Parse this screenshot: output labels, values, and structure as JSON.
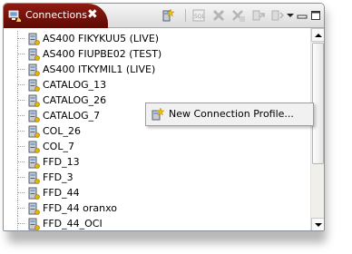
{
  "view": {
    "title": "Connections",
    "close_glyph": "✖",
    "tab_icon": "connections-icon",
    "accent_color": "#7a130b"
  },
  "toolbar": [
    {
      "name": "new-connection-button",
      "icon": "new-connection-icon",
      "enabled": true
    },
    {
      "name": "connect-button",
      "icon": "sql-icon",
      "enabled": false
    },
    {
      "name": "delete-button",
      "icon": "delete-icon",
      "enabled": false
    },
    {
      "name": "disconnect-button",
      "icon": "disconnect-icon",
      "enabled": false
    },
    {
      "name": "refresh-button",
      "icon": "refresh-icon",
      "enabled": false
    },
    {
      "name": "properties-button",
      "icon": "properties-icon",
      "enabled": false
    },
    {
      "name": "view-menu-button",
      "icon": "chevron-down-icon",
      "enabled": true
    },
    {
      "name": "minimize-button",
      "icon": "minimize-icon",
      "enabled": true
    },
    {
      "name": "maximize-button",
      "icon": "maximize-icon",
      "enabled": true
    }
  ],
  "connections": [
    "AS400 FIKYKUU5 (LIVE)",
    "AS400 FIUPBE02 (TEST)",
    "AS400 ITKYMIL1 (LIVE)",
    "CATALOG_13",
    "CATALOG_26",
    "CATALOG_7",
    "COL_26",
    "COL_7",
    "FFD_13",
    "FFD_3",
    "FFD_44",
    "FFD_44 oranxo",
    "FFD_44_OCI"
  ],
  "context_menu": {
    "items": [
      {
        "label": "New Connection Profile...",
        "icon": "new-connection-icon"
      }
    ]
  }
}
